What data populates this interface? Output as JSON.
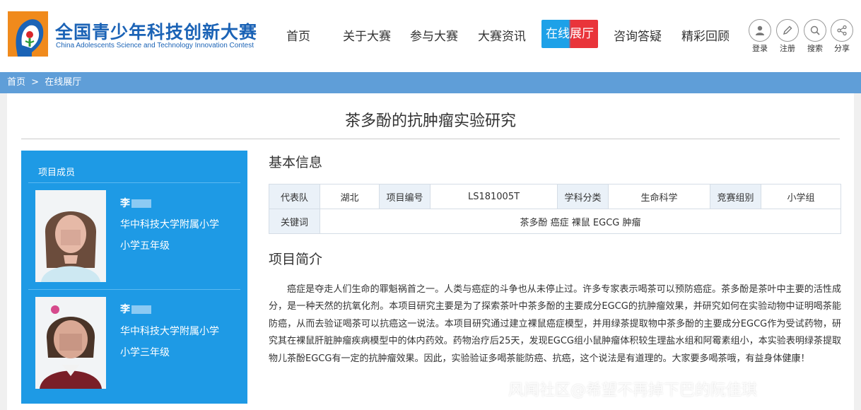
{
  "brand": {
    "name_cn": "全国青少年科技创新大赛",
    "name_en": "China Adolescents Science and Technology Innovation Contest"
  },
  "nav": {
    "items": [
      "首页",
      "关于大赛",
      "参与大赛",
      "大赛资讯",
      "在线展厅",
      "咨询答疑",
      "精彩回顾"
    ],
    "active": "在线展厅"
  },
  "utilities": [
    {
      "label": "登录",
      "icon": "user-icon"
    },
    {
      "label": "注册",
      "icon": "pencil-icon"
    },
    {
      "label": "搜索",
      "icon": "search-icon"
    },
    {
      "label": "分享",
      "icon": "share-icon"
    }
  ],
  "breadcrumb": [
    "首页",
    ">",
    "在线展厅"
  ],
  "project": {
    "title": "茶多酚的抗肿瘤实验研究",
    "members_heading": "项目成员",
    "members": [
      {
        "name": "李",
        "school": "华中科技大学附属小学",
        "grade": "小学五年级"
      },
      {
        "name": "李",
        "school": "华中科技大学附属小学",
        "grade": "小学三年级"
      }
    ],
    "basic_info_heading": "基本信息",
    "info": {
      "team_label": "代表队",
      "team": "湖北",
      "id_label": "项目编号",
      "id": "LS181005T",
      "subject_label": "学科分类",
      "subject": "生命科学",
      "group_label": "竞赛组别",
      "group": "小学组",
      "keywords_label": "关键词",
      "keywords": "茶多酚 癌症 裸鼠 EGCG 肿瘤"
    },
    "summary_heading": "项目简介",
    "summary": "癌症是夺走人们生命的罪魁祸首之一。人类与癌症的斗争也从未停止过。许多专家表示喝茶可以预防癌症。茶多酚是茶叶中主要的活性成分，是一种天然的抗氧化剂。本项目研究主要是为了探索茶叶中茶多酚的主要成分EGCG的抗肿瘤效果，并研究如何在实验动物中证明喝茶能防癌，从而去验证喝茶可以抗癌这一说法。本项目研究通过建立裸鼠癌症模型，并用绿茶提取物中茶多酚的主要成分EGCG作为受试药物，研究其在裸鼠肝脏肿瘤疾病模型中的体内药效。药物治疗后25天，发现EGCG组小鼠肿瘤体积较生理盐水组和阿霉素组小，本实验表明绿茶提取物儿茶酚EGCG有一定的抗肿瘤效果。因此，实验验证多喝茶能防癌、抗癌，这个说法是有道理的。大家要多喝茶哦，有益身体健康！"
  },
  "watermark": "风闻社区@希望不再掉下巴的阮佳琪"
}
